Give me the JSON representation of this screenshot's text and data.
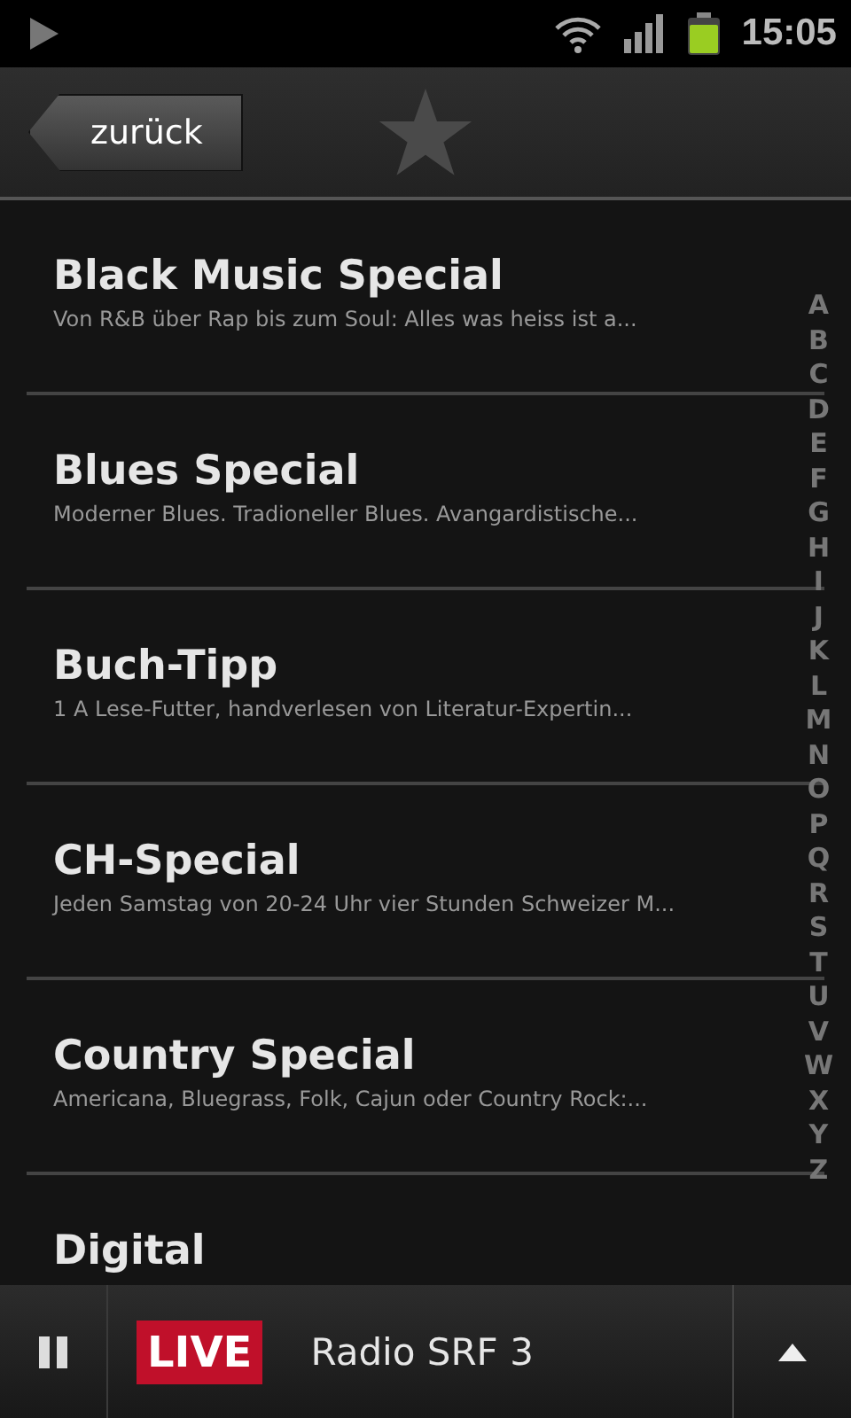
{
  "status_bar": {
    "time": "15:05"
  },
  "header": {
    "back_label": "zurück"
  },
  "shows": [
    {
      "title": "Black Music Special",
      "description": "Von R&B über Rap bis zum Soul: Alles was heiss ist a..."
    },
    {
      "title": "Blues Special",
      "description": "Moderner Blues. Tradioneller Blues. Avangardistische..."
    },
    {
      "title": "Buch-Tipp",
      "description": "1 A Lese-Futter, handverlesen von Literatur-Expertin..."
    },
    {
      "title": "CH-Special",
      "description": "Jeden Samstag von 20-24 Uhr vier Stunden Schweizer M..."
    },
    {
      "title": "Country Special",
      "description": "Americana, Bluegrass, Folk, Cajun oder Country Rock:..."
    },
    {
      "title": "Digital"
    }
  ],
  "index_letters": [
    "A",
    "B",
    "C",
    "D",
    "E",
    "F",
    "G",
    "H",
    "I",
    "J",
    "K",
    "L",
    "M",
    "N",
    "O",
    "P",
    "Q",
    "R",
    "S",
    "T",
    "U",
    "V",
    "W",
    "X",
    "Y",
    "Z"
  ],
  "player": {
    "badge": "LIVE",
    "station": "Radio SRF 3"
  }
}
